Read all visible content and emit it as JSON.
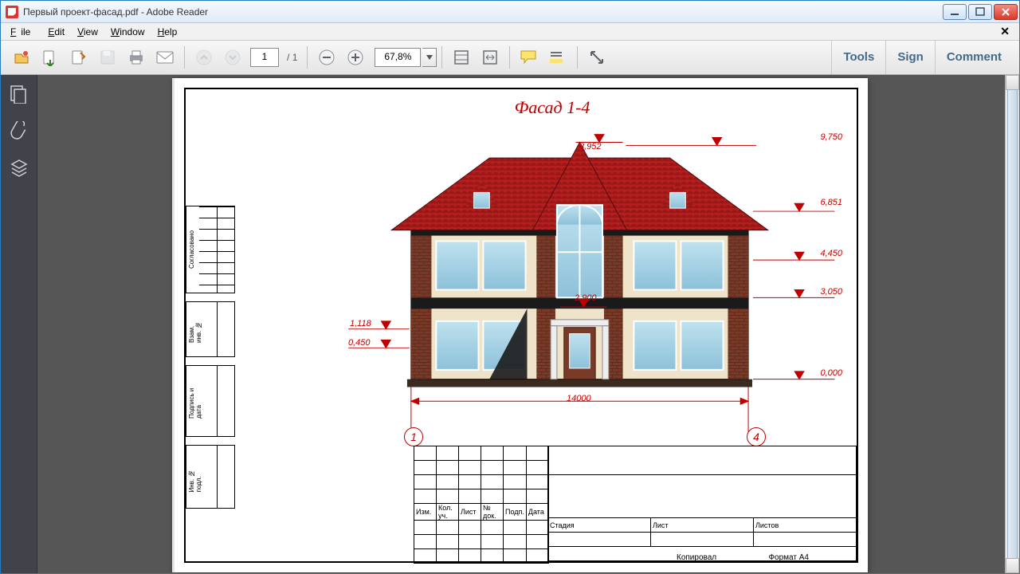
{
  "window": {
    "title": "Первый проект-фасад.pdf - Adobe Reader"
  },
  "menu": {
    "file": "File",
    "edit": "Edit",
    "view": "View",
    "window": "Window",
    "help": "Help"
  },
  "toolbar": {
    "page_current": "1",
    "page_sep": "/",
    "page_total": "1",
    "zoom": "67,8%"
  },
  "panes": {
    "tools": "Tools",
    "sign": "Sign",
    "comment": "Comment"
  },
  "drawing": {
    "caption": "Фасад 1-4",
    "width_dim": "14000",
    "axis_left": "1",
    "axis_right": "4",
    "elev": {
      "roof_peak": "9,750",
      "roof_top": "8,952",
      "eave": "6,851",
      "l2_head": "4,450",
      "l2_sill": "3,050",
      "canopy": "2,900",
      "l1_head": "1,118",
      "l1_sill": "0,450",
      "ground": "0,000"
    }
  },
  "sidecol": {
    "a": "Согласовано",
    "b": "Взам. инв. №",
    "c": "Подпись и дата",
    "d": "Инв. № подл."
  },
  "titleblock": {
    "hdr": [
      "Изм.",
      "Кол. уч.",
      "Лист",
      "№ док.",
      "Подп.",
      "Дата"
    ],
    "right": [
      "Стадия",
      "Лист",
      "Листов"
    ],
    "copy": "Копировал",
    "format": "Формат А4"
  }
}
